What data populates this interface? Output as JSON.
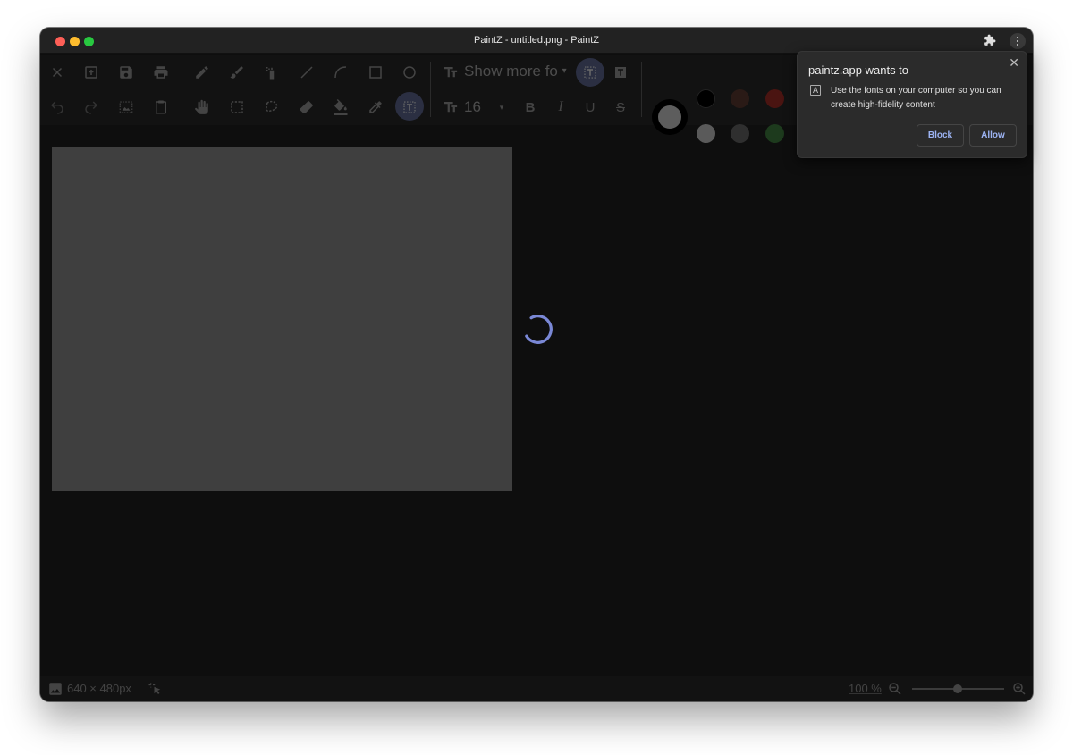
{
  "window": {
    "title": "PaintZ - untitled.png - PaintZ"
  },
  "toolbar": {
    "font_name": "Show more fo",
    "font_size": "16",
    "bold_label": "B",
    "italic_label": "I",
    "underline_label": "U",
    "strike_label": "S"
  },
  "colors": {
    "accent": "#7a88d6",
    "canvas": "#3f3f3f",
    "palette_row1": [
      "#000000",
      "#2a1a16",
      "#4a1411"
    ],
    "palette_row2": [
      "#5a5a5a",
      "#2f2f2f",
      "#1d3a1d"
    ],
    "primary_color": "#5d5d5d"
  },
  "status": {
    "dimensions": "640 × 480px",
    "zoom": "100 %",
    "zoom_level": 0.5
  },
  "permission_popup": {
    "title": "paintz.app wants to",
    "message": "Use the fonts on your computer so you can create high-fidelity content",
    "block_label": "Block",
    "allow_label": "Allow"
  }
}
